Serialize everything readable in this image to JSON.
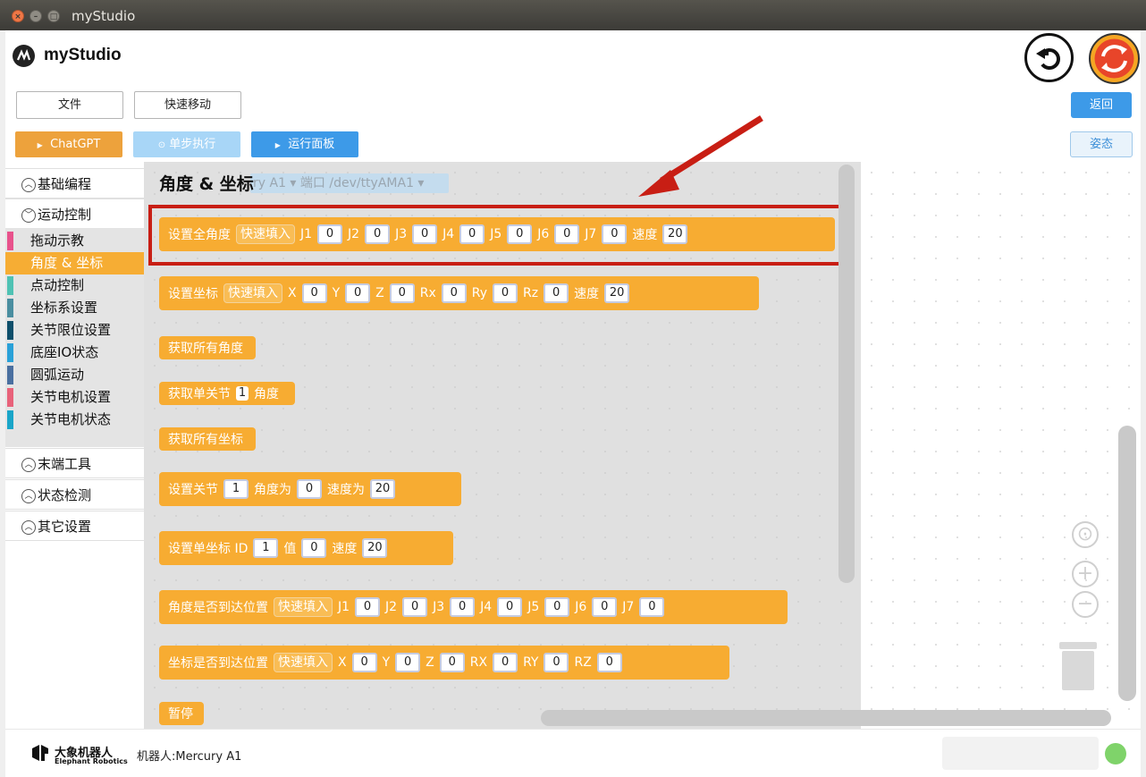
{
  "window": {
    "title": "myStudio"
  },
  "header": {
    "app_name": "myStudio",
    "buttons": {
      "file": "文件",
      "quick_move": "快速移动",
      "chatgpt": "ChatGPT",
      "step": "单步执行",
      "run_panel": "运行面板",
      "back": "返回",
      "pose": "姿态"
    }
  },
  "sidebar": {
    "categories": [
      {
        "label": "基础编程",
        "expanded": false
      },
      {
        "label": "运动控制",
        "expanded": true
      },
      {
        "label": "末端工具",
        "expanded": false
      },
      {
        "label": "状态检测",
        "expanded": false
      },
      {
        "label": "其它设置",
        "expanded": false
      }
    ],
    "subitems": [
      {
        "label": "拖动示教",
        "color": "#e8528c"
      },
      {
        "label": "角度 & 坐标",
        "color": "#f6ad34",
        "active": true
      },
      {
        "label": "点动控制",
        "color": "#4fc2b4"
      },
      {
        "label": "坐标系设置",
        "color": "#4a8ea0"
      },
      {
        "label": "关节限位设置",
        "color": "#0e4f6b"
      },
      {
        "label": "底座IO状态",
        "color": "#2aa1d8"
      },
      {
        "label": "圆弧运动",
        "color": "#4a6fa0"
      },
      {
        "label": "关节电机设置",
        "color": "#e8627a"
      },
      {
        "label": "关节电机状态",
        "color": "#19a5c8"
      }
    ]
  },
  "flyout": {
    "title": "角度 & 坐标",
    "robot_select": "ry A1 ▾  端口 /dev/ttyAMA1 ▾",
    "blocks": {
      "set_all_angles": {
        "label": "设置全角度",
        "chip": "快速填入",
        "fields": [
          "J1",
          "J2",
          "J3",
          "J4",
          "J5",
          "J6",
          "J7"
        ],
        "values": [
          "0",
          "0",
          "0",
          "0",
          "0",
          "0",
          "0"
        ],
        "speed_label": "速度",
        "speed": "20"
      },
      "set_coords": {
        "label": "设置坐标",
        "chip": "快速填入",
        "fields": [
          "X",
          "Y",
          "Z",
          "Rx",
          "Ry",
          "Rz"
        ],
        "values": [
          "0",
          "0",
          "0",
          "0",
          "0",
          "0"
        ],
        "speed_label": "速度",
        "speed": "20"
      },
      "get_all_angles": {
        "label": "获取所有角度"
      },
      "get_single_joint": {
        "prefix": "获取单关节",
        "value": "1",
        "suffix": "角度"
      },
      "get_all_coords": {
        "label": "获取所有坐标"
      },
      "set_joint": {
        "prefix": "设置关节",
        "joint": "1",
        "angle_label": "角度为",
        "angle": "0",
        "speed_label": "速度为",
        "speed": "20"
      },
      "set_single_coord": {
        "prefix": "设置单坐标 ID",
        "id": "1",
        "value_label": "值",
        "value": "0",
        "speed_label": "速度",
        "speed": "20"
      },
      "angle_reached": {
        "label": "角度是否到达位置",
        "chip": "快速填入",
        "fields": [
          "J1",
          "J2",
          "J3",
          "J4",
          "J5",
          "J6",
          "J7"
        ],
        "values": [
          "0",
          "0",
          "0",
          "0",
          "0",
          "0",
          "0"
        ]
      },
      "coord_reached": {
        "label": "坐标是否到达位置",
        "chip": "快速填入",
        "fields": [
          "X",
          "Y",
          "Z",
          "RX",
          "RY",
          "RZ"
        ],
        "values": [
          "0",
          "0",
          "0",
          "0",
          "0",
          "0"
        ]
      },
      "pause": {
        "label": "暂停"
      }
    }
  },
  "footer": {
    "brand_cn": "大象机器人",
    "brand_en": "Elephant Robotics",
    "robot_label": "机器人:",
    "robot_name": "Mercury A1"
  }
}
